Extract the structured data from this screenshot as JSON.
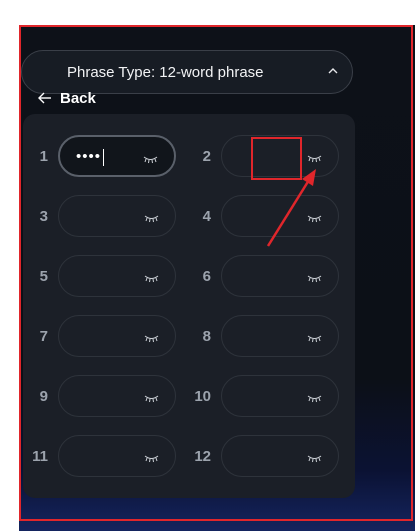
{
  "header": {
    "phrase_type_label": "Phrase Type: 12-word phrase",
    "back_label": "Back"
  },
  "words": [
    {
      "number": "1",
      "value": "••••",
      "active": true
    },
    {
      "number": "2",
      "value": ""
    },
    {
      "number": "3",
      "value": ""
    },
    {
      "number": "4",
      "value": ""
    },
    {
      "number": "5",
      "value": ""
    },
    {
      "number": "6",
      "value": ""
    },
    {
      "number": "7",
      "value": ""
    },
    {
      "number": "8",
      "value": ""
    },
    {
      "number": "9",
      "value": ""
    },
    {
      "number": "10",
      "value": ""
    },
    {
      "number": "11",
      "value": ""
    },
    {
      "number": "12",
      "value": ""
    }
  ],
  "icons": {
    "chevron": "chevron-up-icon",
    "back": "arrow-left-icon",
    "visibility": "eye-closed-icon"
  },
  "colors": {
    "annotation": "#e0262b",
    "text": "#ffffff",
    "muted": "#9ca3ad"
  }
}
